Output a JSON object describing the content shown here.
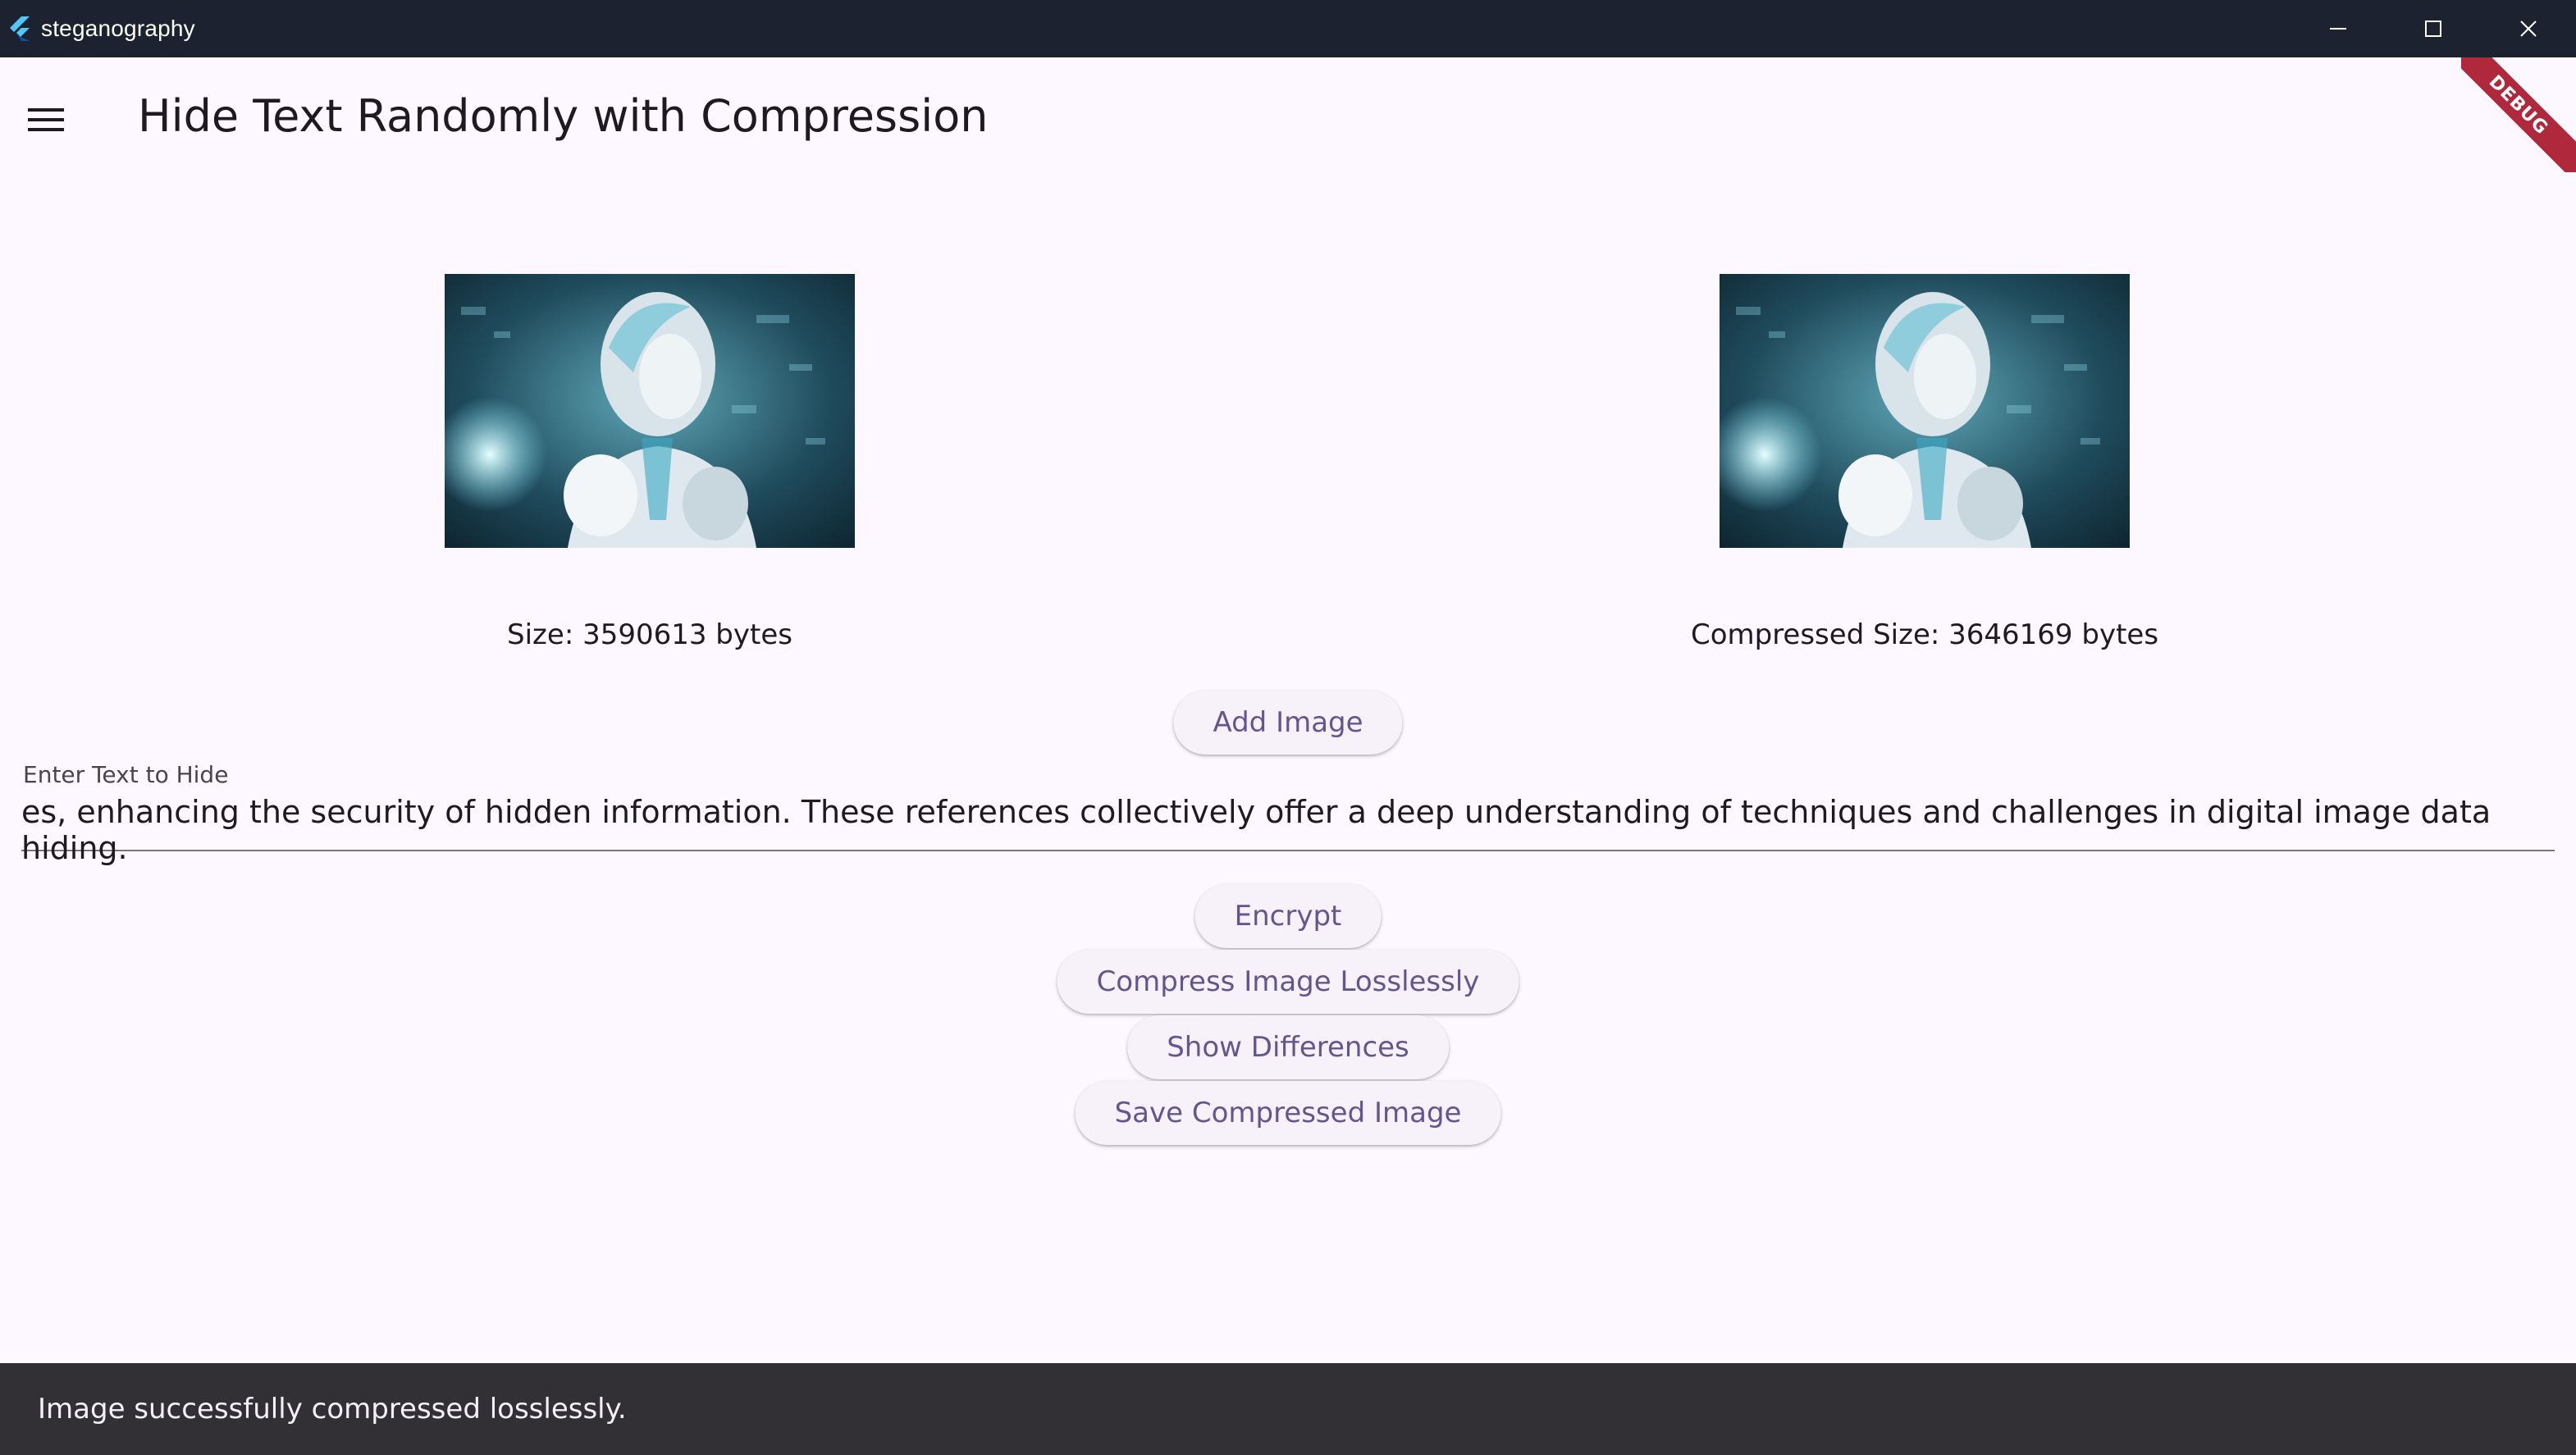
{
  "window": {
    "title": "steganography",
    "minimize_icon": "minimize-icon",
    "maximize_icon": "maximize-icon",
    "close_icon": "close-icon"
  },
  "appbar": {
    "menu_icon": "hamburger-menu-icon",
    "title": "Hide Text Randomly with Compression"
  },
  "debug_banner": {
    "label": "DEBUG",
    "color": "#b0283b"
  },
  "images": {
    "original": {
      "size_text": "Size: 3590613 bytes"
    },
    "compressed": {
      "size_text": "Compressed Size: 3646169 bytes"
    }
  },
  "buttons": {
    "add_image": "Add Image",
    "encrypt": "Encrypt",
    "compress": "Compress Image Losslessly",
    "show_differences": "Show Differences",
    "save": "Save Compressed Image"
  },
  "text_field": {
    "label": "Enter Text to Hide",
    "value": "es, enhancing the security of hidden information. These references collectively offer a deep understanding of techniques and challenges in digital image data hiding."
  },
  "snackbar": {
    "message": "Image successfully compressed losslessly."
  },
  "colors": {
    "background": "#fdf7ff",
    "accent": "#65558f",
    "titlebar": "#1c2230",
    "snackbar": "#322f35"
  }
}
